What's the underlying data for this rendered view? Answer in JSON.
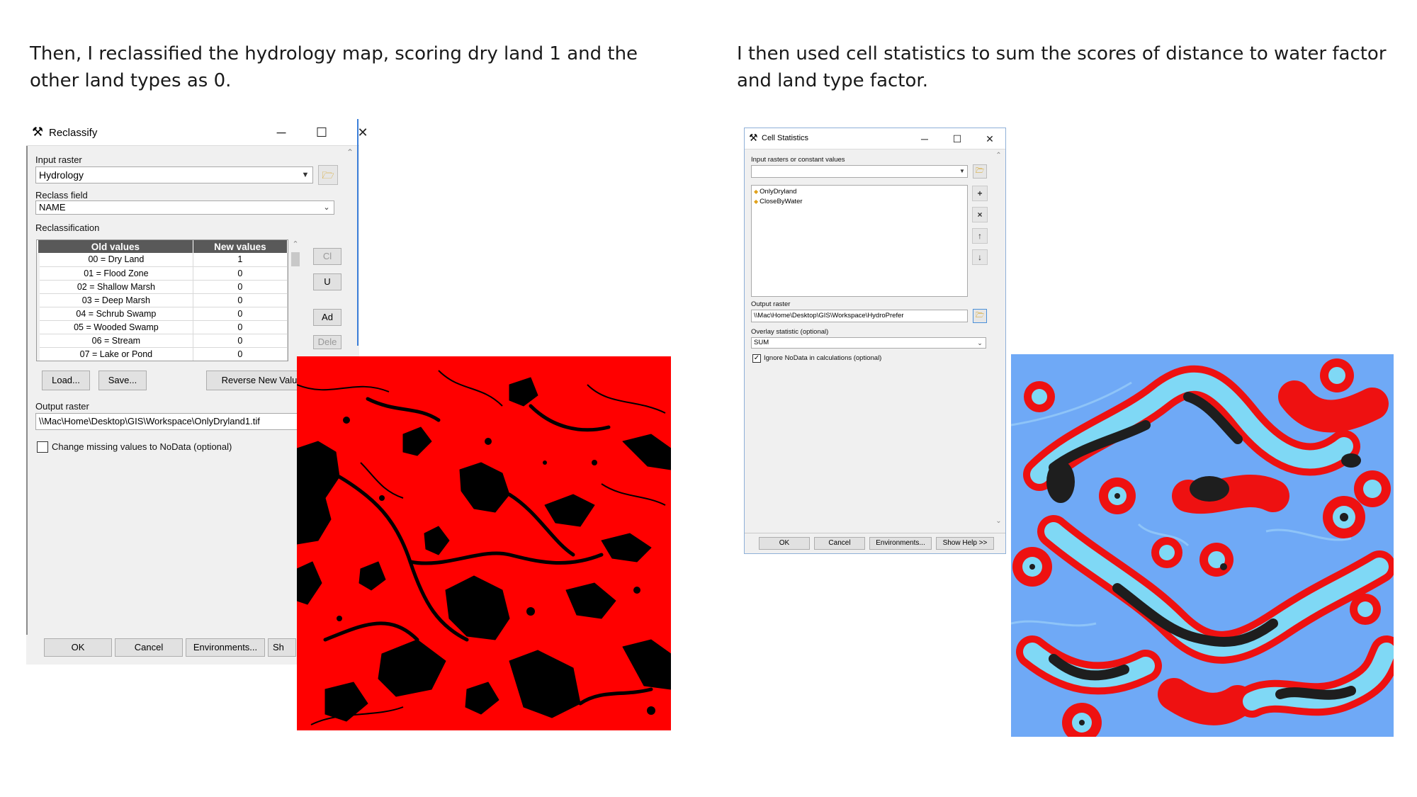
{
  "captions": {
    "left": "Then, I reclassified the hydrology map, scoring dry land 1 and the other land types as 0.",
    "right": "I then used cell statistics to sum the scores of distance to water factor and land type factor."
  },
  "reclassify": {
    "title": "Reclassify",
    "title_icon": "hammer-icon",
    "input_raster_label": "Input raster",
    "input_raster_value": "Hydrology",
    "reclass_field_label": "Reclass field",
    "reclass_field_value": "NAME",
    "reclassification_label": "Reclassification",
    "table_headers": [
      "Old values",
      "New values"
    ],
    "rows": [
      {
        "old": "00 = Dry Land",
        "new": "1"
      },
      {
        "old": "01 = Flood Zone",
        "new": "0"
      },
      {
        "old": "02 = Shallow Marsh",
        "new": "0"
      },
      {
        "old": "03 = Deep Marsh",
        "new": "0"
      },
      {
        "old": "04 = Schrub Swamp",
        "new": "0"
      },
      {
        "old": "05 = Wooded Swamp",
        "new": "0"
      },
      {
        "old": "06 = Stream",
        "new": "0"
      },
      {
        "old": "07 = Lake or Pond",
        "new": "0"
      }
    ],
    "side_buttons": [
      "Cl",
      "U",
      "Ad",
      "Dele"
    ],
    "load_label": "Load...",
    "save_label": "Save...",
    "reverse_label": "Reverse New Valu",
    "output_raster_label": "Output raster",
    "output_raster_value": "\\\\Mac\\Home\\Desktop\\GIS\\Workspace\\OnlyDryland1.tif",
    "nodata_label": "Change missing values to NoData (optional)",
    "nodata_checked": false,
    "ok_label": "OK",
    "cancel_label": "Cancel",
    "env_label": "Environments...",
    "help_label": "Sh"
  },
  "cell_statistics": {
    "title": "Cell Statistics",
    "title_icon": "hammer-icon",
    "input_label": "Input rasters or constant values",
    "input_value": "",
    "list_items": [
      "OnlyDryland",
      "CloseByWater"
    ],
    "list_buttons": [
      "+",
      "×",
      "↑",
      "↓"
    ],
    "output_raster_label": "Output raster",
    "output_raster_value": "\\\\Mac\\Home\\Desktop\\GIS\\Workspace\\HydroPrefer",
    "overlay_label": "Overlay statistic (optional)",
    "overlay_value": "SUM",
    "ignore_nodata_label": "Ignore NoData in calculations (optional)",
    "ignore_nodata_checked": true,
    "ok_label": "OK",
    "cancel_label": "Cancel",
    "env_label": "Environments...",
    "help_label": "Show Help >>"
  },
  "maps": {
    "dryland": {
      "land_color": "#ff0000",
      "other_color": "#000000"
    },
    "sum": {
      "background_color": "#6fa9f6",
      "buffer_color": "#ee1111",
      "water_color": "#7fd8f5",
      "land_color": "#1e1e1e"
    }
  }
}
